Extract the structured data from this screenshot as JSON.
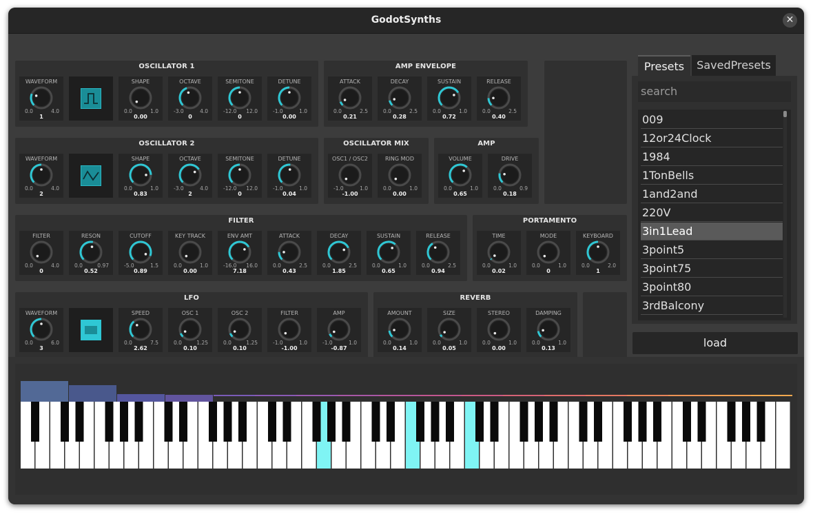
{
  "window": {
    "title": "GodotSynths",
    "close_glyph": "✕"
  },
  "accent_color": "#2fc7d4",
  "panels": [
    {
      "id": "osc1",
      "title": "OSCILLATOR 1",
      "knobs": [
        {
          "label": "WAVEFORM",
          "min": "0.0",
          "max": "4.0",
          "value": "1",
          "fraction": 0.25
        },
        {
          "type": "wave",
          "icon": "square-wave-icon"
        },
        {
          "label": "SHAPE",
          "min": "0.0",
          "max": "1.0",
          "value": "0.00",
          "fraction": 0.0
        },
        {
          "label": "OCTAVE",
          "min": "-3.0",
          "max": "4.0",
          "value": "0",
          "fraction": 0.43
        },
        {
          "label": "SEMITONE",
          "min": "-12.0",
          "max": "12.0",
          "value": "0",
          "fraction": 0.5
        },
        {
          "label": "DETUNE",
          "min": "-1.0",
          "max": "1.0",
          "value": "0.00",
          "fraction": 0.5
        }
      ]
    },
    {
      "id": "ampenv",
      "title": "AMP ENVELOPE",
      "knobs": [
        {
          "label": "ATTACK",
          "min": "0.0",
          "max": "2.5",
          "value": "0.21",
          "fraction": 0.084
        },
        {
          "label": "DECAY",
          "min": "0.0",
          "max": "2.5",
          "value": "0.28",
          "fraction": 0.112
        },
        {
          "label": "SUSTAIN",
          "min": "0.0",
          "max": "1.0",
          "value": "0.72",
          "fraction": 0.72
        },
        {
          "label": "RELEASE",
          "min": "0.0",
          "max": "2.5",
          "value": "0.40",
          "fraction": 0.16
        }
      ]
    },
    {
      "id": "osc2",
      "title": "OSCILLATOR 2",
      "knobs": [
        {
          "label": "WAVEFORM",
          "min": "0.0",
          "max": "4.0",
          "value": "2",
          "fraction": 0.5
        },
        {
          "type": "wave",
          "icon": "triangle-wave-icon"
        },
        {
          "label": "SHAPE",
          "min": "0.0",
          "max": "1.0",
          "value": "0.83",
          "fraction": 0.83
        },
        {
          "label": "OCTAVE",
          "min": "-3.0",
          "max": "4.0",
          "value": "2",
          "fraction": 0.71
        },
        {
          "label": "SEMITONE",
          "min": "-12.0",
          "max": "12.0",
          "value": "0",
          "fraction": 0.5
        },
        {
          "label": "DETUNE",
          "min": "-1.0",
          "max": "1.0",
          "value": "0.04",
          "fraction": 0.52
        }
      ]
    },
    {
      "id": "oscmix",
      "title": "OSCILLATOR MIX",
      "knobs": [
        {
          "label": "OSC1 / OSC2",
          "min": "-1.0",
          "max": "1.0",
          "value": "-1.00",
          "fraction": 0.0
        },
        {
          "label": "RING MOD",
          "min": "0.0",
          "max": "1.0",
          "value": "0.00",
          "fraction": 0.0
        }
      ]
    },
    {
      "id": "amp",
      "title": "AMP",
      "knobs": [
        {
          "label": "VOLUME",
          "min": "0.0",
          "max": "1.0",
          "value": "0.65",
          "fraction": 0.65
        },
        {
          "label": "DRIVE",
          "min": "0.0",
          "max": "0.9",
          "value": "0.18",
          "fraction": 0.2
        }
      ]
    },
    {
      "id": "filter",
      "title": "FILTER",
      "knobs": [
        {
          "label": "FILTER",
          "min": "0.0",
          "max": "4.0",
          "value": "0",
          "fraction": 0.0
        },
        {
          "label": "RESON",
          "min": "0.0",
          "max": "0.97",
          "value": "0.52",
          "fraction": 0.54
        },
        {
          "label": "CUTOFF",
          "min": "-5.0",
          "max": "1.5",
          "value": "0.89",
          "fraction": 0.91
        },
        {
          "label": "KEY TRACK",
          "min": "0.0",
          "max": "1.0",
          "value": "0.00",
          "fraction": 0.0
        },
        {
          "label": "ENV AMT",
          "min": "-16.0",
          "max": "16.0",
          "value": "7.18",
          "fraction": 0.72
        },
        {
          "label": "ATTACK",
          "min": "0.0",
          "max": "2.5",
          "value": "0.43",
          "fraction": 0.17
        },
        {
          "label": "DECAY",
          "min": "0.0",
          "max": "2.5",
          "value": "1.85",
          "fraction": 0.74
        },
        {
          "label": "SUSTAIN",
          "min": "0.0",
          "max": "1.0",
          "value": "0.65",
          "fraction": 0.65
        },
        {
          "label": "RELEASE",
          "min": "0.0",
          "max": "2.5",
          "value": "0.94",
          "fraction": 0.38
        }
      ]
    },
    {
      "id": "porta",
      "title": "PORTAMENTO",
      "knobs": [
        {
          "label": "TIME",
          "min": "0.0",
          "max": "1.0",
          "value": "0.02",
          "fraction": 0.02
        },
        {
          "label": "MODE",
          "min": "0.0",
          "max": "1.0",
          "value": "0",
          "fraction": 0.0
        },
        {
          "label": "KEYBOARD",
          "min": "0.0",
          "max": "2.0",
          "value": "1",
          "fraction": 0.5
        }
      ]
    },
    {
      "id": "lfo",
      "title": "LFO",
      "knobs": [
        {
          "label": "WAVEFORM",
          "min": "0.0",
          "max": "6.0",
          "value": "3",
          "fraction": 0.5
        },
        {
          "type": "wave",
          "icon": "pulse-wave-icon"
        },
        {
          "label": "SPEED",
          "min": "0.0",
          "max": "7.5",
          "value": "2.62",
          "fraction": 0.35
        },
        {
          "label": "OSC 1",
          "min": "0.0",
          "max": "1.25",
          "value": "0.10",
          "fraction": 0.08
        },
        {
          "label": "OSC 2",
          "min": "0.0",
          "max": "1.25",
          "value": "0.10",
          "fraction": 0.08
        },
        {
          "label": "FILTER",
          "min": "-1.0",
          "max": "1.0",
          "value": "-1.00",
          "fraction": 0.0
        },
        {
          "label": "AMP",
          "min": "-1.0",
          "max": "1.0",
          "value": "-0.87",
          "fraction": 0.07
        }
      ]
    },
    {
      "id": "reverb",
      "title": "REVERB",
      "knobs": [
        {
          "label": "AMOUNT",
          "min": "0.0",
          "max": "1.0",
          "value": "0.14",
          "fraction": 0.14
        },
        {
          "label": "SIZE",
          "min": "0.0",
          "max": "1.0",
          "value": "0.05",
          "fraction": 0.05
        },
        {
          "label": "STEREO",
          "min": "0.0",
          "max": "1.0",
          "value": "0.00",
          "fraction": 0.0
        },
        {
          "label": "DAMPING",
          "min": "0.0",
          "max": "1.0",
          "value": "0.13",
          "fraction": 0.13
        }
      ]
    }
  ],
  "presets": {
    "tabs": [
      "Presets",
      "SavedPresets"
    ],
    "active_tab": 0,
    "search_placeholder": "search",
    "items": [
      "009",
      "12or24Clock",
      "1984",
      "1TonBells",
      "1and2and",
      "220V",
      "3in1Lead",
      "3point5",
      "3point75",
      "3point80",
      "3rdBalcony"
    ],
    "selected_index": 6,
    "load_label": "load"
  },
  "keyboard": {
    "white_key_count": 52,
    "pressed_white_keys": [
      20,
      26,
      30
    ]
  }
}
